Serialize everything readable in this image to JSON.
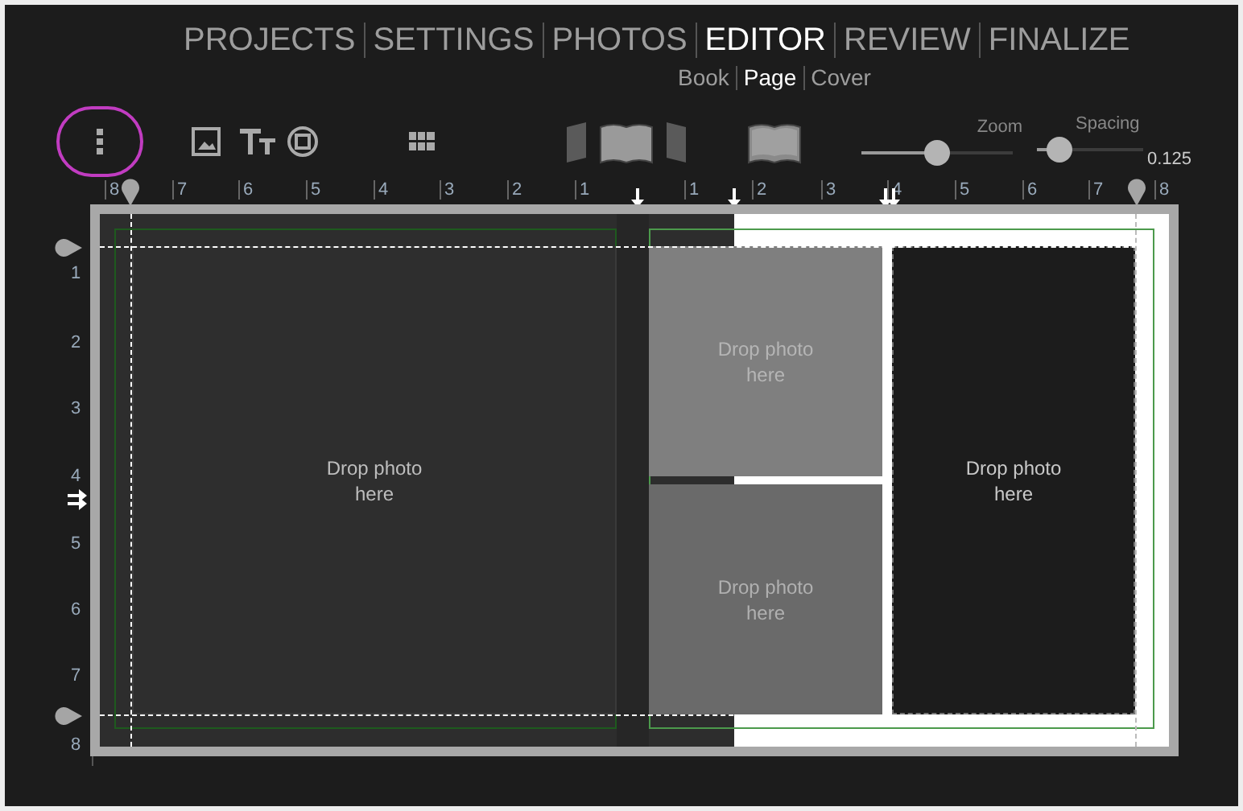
{
  "nav": [
    {
      "label": "PROJECTS",
      "selected": false
    },
    {
      "label": "SETTINGS",
      "selected": false
    },
    {
      "label": "PHOTOS",
      "selected": false
    },
    {
      "label": "EDITOR",
      "selected": true
    },
    {
      "label": "REVIEW",
      "selected": false
    },
    {
      "label": "FINALIZE",
      "selected": false
    }
  ],
  "subtabs": [
    {
      "label": "Book",
      "selected": false
    },
    {
      "label": "Page",
      "selected": true
    },
    {
      "label": "Cover",
      "selected": false
    }
  ],
  "view_modes": [
    {
      "kind": "left",
      "selected": false
    },
    {
      "kind": "spread",
      "selected": true
    },
    {
      "kind": "right",
      "selected": false
    }
  ],
  "zoom": {
    "label": "Zoom",
    "level": 0.5
  },
  "spacing": {
    "label": "Spacing",
    "level": 0.2,
    "reading": "0.125"
  },
  "ruler": {
    "horizontal": [
      "8",
      "7",
      "6",
      "5",
      "4",
      "3",
      "2",
      "1",
      "1",
      "2",
      "3",
      "4",
      "5",
      "6",
      "7",
      "8"
    ],
    "vertical": [
      "1",
      "2",
      "3",
      "4",
      "5",
      "6",
      "7",
      "8"
    ]
  },
  "frames": [
    {
      "placeholder": "Drop photo here"
    },
    {
      "placeholder": "Drop photo here"
    },
    {
      "placeholder": "Drop photo here"
    },
    {
      "placeholder": "Drop photo here"
    }
  ]
}
